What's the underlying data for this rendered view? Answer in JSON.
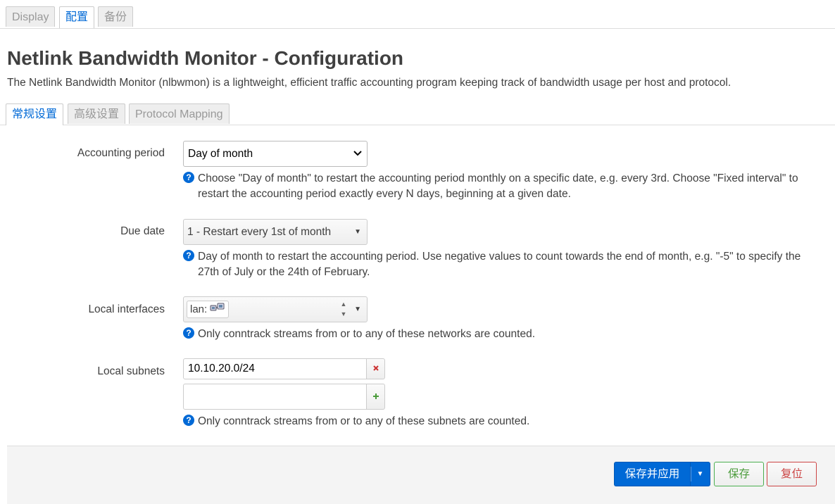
{
  "top_tabs": [
    "Display",
    "配置",
    "备份"
  ],
  "page": {
    "title": "Netlink Bandwidth Monitor - Configuration",
    "description": "The Netlink Bandwidth Monitor (nlbwmon) is a lightweight, efficient traffic accounting program keeping track of bandwidth usage per host and protocol."
  },
  "sub_tabs": [
    "常规设置",
    "高级设置",
    "Protocol Mapping"
  ],
  "fields": {
    "accounting_period": {
      "label": "Accounting period",
      "value": "Day of month",
      "help_line1": "Choose \"Day of month\" to restart the accounting period monthly on a specific date, e.g. every 3rd. Choose \"Fixed interval\" to",
      "help_line2": "restart the accounting period exactly every N days, beginning at a given date."
    },
    "due_date": {
      "label": "Due date",
      "value": "1 - Restart every 1st of month",
      "help_line1": "Day of month to restart the accounting period. Use negative values to count towards the end of month, e.g. \"-5\" to specify the",
      "help_line2": "27th of July or the 24th of February."
    },
    "local_interfaces": {
      "label": "Local interfaces",
      "chip": "lan:",
      "help": "Only conntrack streams from or to any of these networks are counted."
    },
    "local_subnets": {
      "label": "Local subnets",
      "value": "10.10.20.0/24",
      "new_value": "",
      "help": "Only conntrack streams from or to any of these subnets are counted."
    }
  },
  "icons": {
    "help": "help-icon",
    "remove": "remove-icon",
    "add": "add-icon",
    "network": "network-icon"
  },
  "footer": {
    "save_apply": "保存并应用",
    "save": "保存",
    "reset": "复位"
  },
  "colors": {
    "accent": "#0069d6",
    "save_green": "#4a9b3a",
    "reset_red": "#cc4444"
  }
}
